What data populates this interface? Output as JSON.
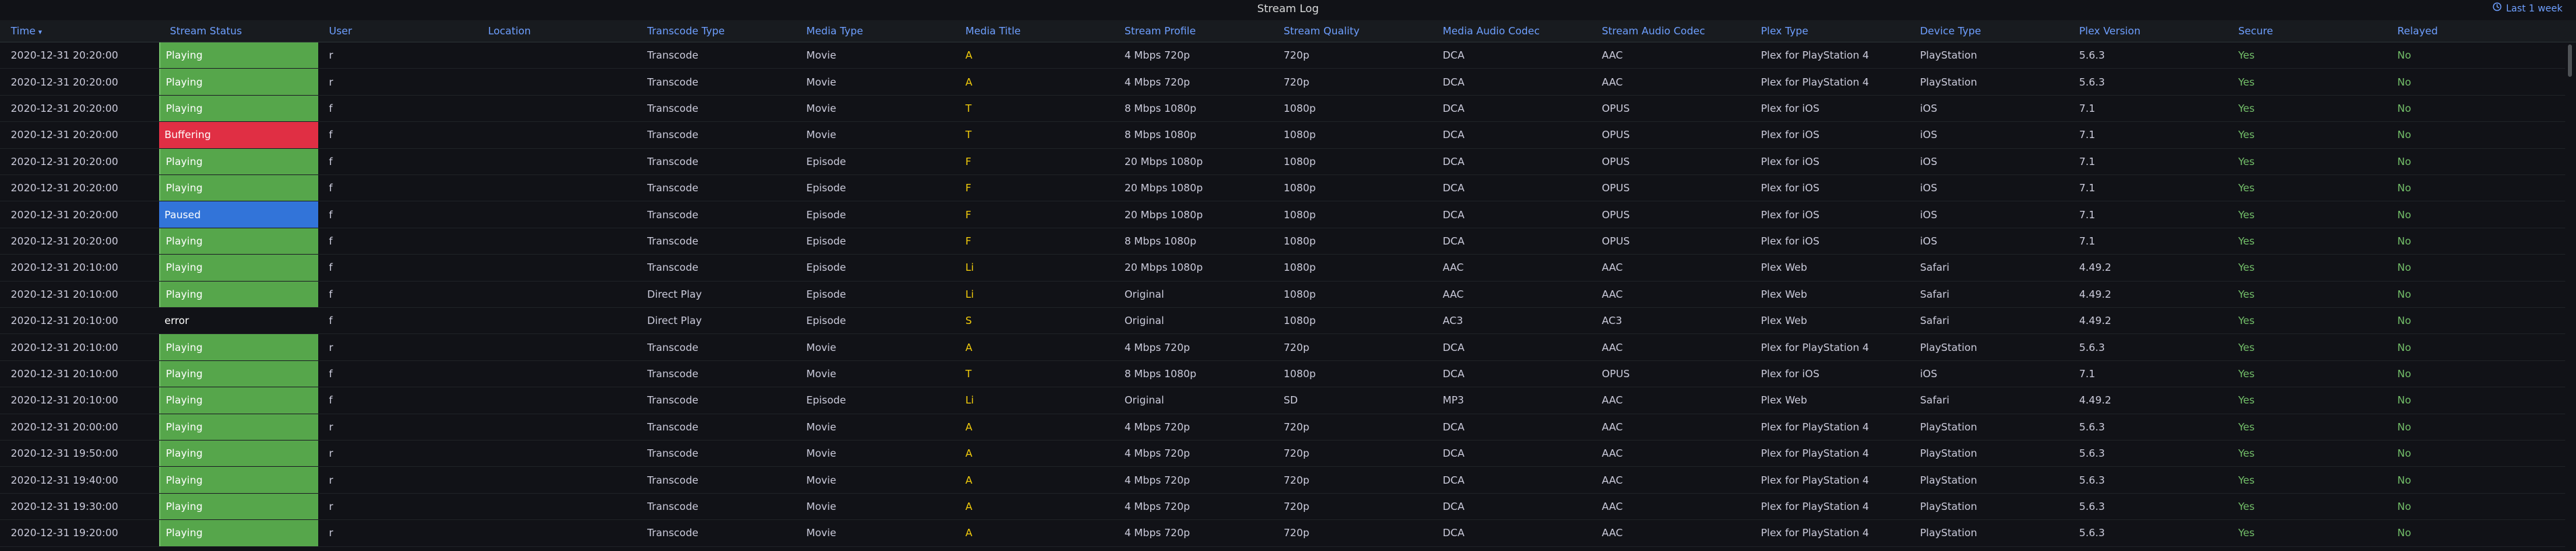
{
  "panel": {
    "title": "Stream Log",
    "time_range_label": "Last 1 week",
    "time_range_icon": "clock-icon",
    "accent": "#6e9fff"
  },
  "columns": [
    {
      "key": "time",
      "label": "Time",
      "sorted": "desc"
    },
    {
      "key": "status",
      "label": "Stream Status"
    },
    {
      "key": "user",
      "label": "User"
    },
    {
      "key": "location",
      "label": "Location"
    },
    {
      "key": "transcode",
      "label": "Transcode Type"
    },
    {
      "key": "media_type",
      "label": "Media Type"
    },
    {
      "key": "media_title",
      "label": "Media Title"
    },
    {
      "key": "profile",
      "label": "Stream Profile"
    },
    {
      "key": "quality",
      "label": "Stream Quality"
    },
    {
      "key": "media_audio",
      "label": "Media Audio Codec"
    },
    {
      "key": "stream_audio",
      "label": "Stream Audio Codec"
    },
    {
      "key": "plex_type",
      "label": "Plex Type"
    },
    {
      "key": "device",
      "label": "Device Type"
    },
    {
      "key": "version",
      "label": "Plex Version"
    },
    {
      "key": "secure",
      "label": "Secure"
    },
    {
      "key": "relayed",
      "label": "Relayed"
    }
  ],
  "status_colors": {
    "Playing": "#56a64b",
    "Buffering": "#e02f44",
    "Paused": "#3274d9",
    "error": "transparent"
  },
  "rows": [
    {
      "time": "2020-12-31 20:20:00",
      "status": "Playing",
      "user": "r",
      "location": "",
      "transcode": "Transcode",
      "media_type": "Movie",
      "media_title": "A",
      "profile": "4 Mbps 720p",
      "quality": "720p",
      "media_audio": "DCA",
      "stream_audio": "AAC",
      "plex_type": "Plex for PlayStation 4",
      "device": "PlayStation",
      "version": "5.6.3",
      "secure": "Yes",
      "relayed": "No"
    },
    {
      "time": "2020-12-31 20:20:00",
      "status": "Playing",
      "user": "r",
      "location": "",
      "transcode": "Transcode",
      "media_type": "Movie",
      "media_title": "A",
      "profile": "4 Mbps 720p",
      "quality": "720p",
      "media_audio": "DCA",
      "stream_audio": "AAC",
      "plex_type": "Plex for PlayStation 4",
      "device": "PlayStation",
      "version": "5.6.3",
      "secure": "Yes",
      "relayed": "No"
    },
    {
      "time": "2020-12-31 20:20:00",
      "status": "Playing",
      "user": "f",
      "location": "",
      "transcode": "Transcode",
      "media_type": "Movie",
      "media_title": "T",
      "profile": "8 Mbps 1080p",
      "quality": "1080p",
      "media_audio": "DCA",
      "stream_audio": "OPUS",
      "plex_type": "Plex for iOS",
      "device": "iOS",
      "version": "7.1",
      "secure": "Yes",
      "relayed": "No"
    },
    {
      "time": "2020-12-31 20:20:00",
      "status": "Buffering",
      "user": "f",
      "location": "",
      "transcode": "Transcode",
      "media_type": "Movie",
      "media_title": "T",
      "profile": "8 Mbps 1080p",
      "quality": "1080p",
      "media_audio": "DCA",
      "stream_audio": "OPUS",
      "plex_type": "Plex for iOS",
      "device": "iOS",
      "version": "7.1",
      "secure": "Yes",
      "relayed": "No"
    },
    {
      "time": "2020-12-31 20:20:00",
      "status": "Playing",
      "user": "f",
      "location": "",
      "transcode": "Transcode",
      "media_type": "Episode",
      "media_title": "F",
      "profile": "20 Mbps 1080p",
      "quality": "1080p",
      "media_audio": "DCA",
      "stream_audio": "OPUS",
      "plex_type": "Plex for iOS",
      "device": "iOS",
      "version": "7.1",
      "secure": "Yes",
      "relayed": "No"
    },
    {
      "time": "2020-12-31 20:20:00",
      "status": "Playing",
      "user": "f",
      "location": "",
      "transcode": "Transcode",
      "media_type": "Episode",
      "media_title": "F",
      "profile": "20 Mbps 1080p",
      "quality": "1080p",
      "media_audio": "DCA",
      "stream_audio": "OPUS",
      "plex_type": "Plex for iOS",
      "device": "iOS",
      "version": "7.1",
      "secure": "Yes",
      "relayed": "No"
    },
    {
      "time": "2020-12-31 20:20:00",
      "status": "Paused",
      "user": "f",
      "location": "",
      "transcode": "Transcode",
      "media_type": "Episode",
      "media_title": "F",
      "profile": "20 Mbps 1080p",
      "quality": "1080p",
      "media_audio": "DCA",
      "stream_audio": "OPUS",
      "plex_type": "Plex for iOS",
      "device": "iOS",
      "version": "7.1",
      "secure": "Yes",
      "relayed": "No"
    },
    {
      "time": "2020-12-31 20:20:00",
      "status": "Playing",
      "user": "f",
      "location": "",
      "transcode": "Transcode",
      "media_type": "Episode",
      "media_title": "F",
      "profile": "8 Mbps 1080p",
      "quality": "1080p",
      "media_audio": "DCA",
      "stream_audio": "OPUS",
      "plex_type": "Plex for iOS",
      "device": "iOS",
      "version": "7.1",
      "secure": "Yes",
      "relayed": "No"
    },
    {
      "time": "2020-12-31 20:10:00",
      "status": "Playing",
      "user": "f",
      "location": "",
      "transcode": "Transcode",
      "media_type": "Episode",
      "media_title": "Li",
      "profile": "20 Mbps 1080p",
      "quality": "1080p",
      "media_audio": "AAC",
      "stream_audio": "AAC",
      "plex_type": "Plex Web",
      "device": "Safari",
      "version": "4.49.2",
      "secure": "Yes",
      "relayed": "No"
    },
    {
      "time": "2020-12-31 20:10:00",
      "status": "Playing",
      "user": "f",
      "location": "",
      "transcode": "Direct Play",
      "media_type": "Episode",
      "media_title": "Li",
      "profile": "Original",
      "quality": "1080p",
      "media_audio": "AAC",
      "stream_audio": "AAC",
      "plex_type": "Plex Web",
      "device": "Safari",
      "version": "4.49.2",
      "secure": "Yes",
      "relayed": "No"
    },
    {
      "time": "2020-12-31 20:10:00",
      "status": "error",
      "user": "f",
      "location": "",
      "transcode": "Direct Play",
      "media_type": "Episode",
      "media_title": "S",
      "profile": "Original",
      "quality": "1080p",
      "media_audio": "AC3",
      "stream_audio": "AC3",
      "plex_type": "Plex Web",
      "device": "Safari",
      "version": "4.49.2",
      "secure": "Yes",
      "relayed": "No"
    },
    {
      "time": "2020-12-31 20:10:00",
      "status": "Playing",
      "user": "r",
      "location": "",
      "transcode": "Transcode",
      "media_type": "Movie",
      "media_title": "A",
      "profile": "4 Mbps 720p",
      "quality": "720p",
      "media_audio": "DCA",
      "stream_audio": "AAC",
      "plex_type": "Plex for PlayStation 4",
      "device": "PlayStation",
      "version": "5.6.3",
      "secure": "Yes",
      "relayed": "No"
    },
    {
      "time": "2020-12-31 20:10:00",
      "status": "Playing",
      "user": "f",
      "location": "",
      "transcode": "Transcode",
      "media_type": "Movie",
      "media_title": "T",
      "profile": "8 Mbps 1080p",
      "quality": "1080p",
      "media_audio": "DCA",
      "stream_audio": "OPUS",
      "plex_type": "Plex for iOS",
      "device": "iOS",
      "version": "7.1",
      "secure": "Yes",
      "relayed": "No"
    },
    {
      "time": "2020-12-31 20:10:00",
      "status": "Playing",
      "user": "f",
      "location": "",
      "transcode": "Transcode",
      "media_type": "Episode",
      "media_title": "Li",
      "profile": "Original",
      "quality": "SD",
      "media_audio": "MP3",
      "stream_audio": "AAC",
      "plex_type": "Plex Web",
      "device": "Safari",
      "version": "4.49.2",
      "secure": "Yes",
      "relayed": "No"
    },
    {
      "time": "2020-12-31 20:00:00",
      "status": "Playing",
      "user": "r",
      "location": "",
      "transcode": "Transcode",
      "media_type": "Movie",
      "media_title": "A",
      "profile": "4 Mbps 720p",
      "quality": "720p",
      "media_audio": "DCA",
      "stream_audio": "AAC",
      "plex_type": "Plex for PlayStation 4",
      "device": "PlayStation",
      "version": "5.6.3",
      "secure": "Yes",
      "relayed": "No"
    },
    {
      "time": "2020-12-31 19:50:00",
      "status": "Playing",
      "user": "r",
      "location": "",
      "transcode": "Transcode",
      "media_type": "Movie",
      "media_title": "A",
      "profile": "4 Mbps 720p",
      "quality": "720p",
      "media_audio": "DCA",
      "stream_audio": "AAC",
      "plex_type": "Plex for PlayStation 4",
      "device": "PlayStation",
      "version": "5.6.3",
      "secure": "Yes",
      "relayed": "No"
    },
    {
      "time": "2020-12-31 19:40:00",
      "status": "Playing",
      "user": "r",
      "location": "",
      "transcode": "Transcode",
      "media_type": "Movie",
      "media_title": "A",
      "profile": "4 Mbps 720p",
      "quality": "720p",
      "media_audio": "DCA",
      "stream_audio": "AAC",
      "plex_type": "Plex for PlayStation 4",
      "device": "PlayStation",
      "version": "5.6.3",
      "secure": "Yes",
      "relayed": "No"
    },
    {
      "time": "2020-12-31 19:30:00",
      "status": "Playing",
      "user": "r",
      "location": "",
      "transcode": "Transcode",
      "media_type": "Movie",
      "media_title": "A",
      "profile": "4 Mbps 720p",
      "quality": "720p",
      "media_audio": "DCA",
      "stream_audio": "AAC",
      "plex_type": "Plex for PlayStation 4",
      "device": "PlayStation",
      "version": "5.6.3",
      "secure": "Yes",
      "relayed": "No"
    },
    {
      "time": "2020-12-31 19:20:00",
      "status": "Playing",
      "user": "r",
      "location": "",
      "transcode": "Transcode",
      "media_type": "Movie",
      "media_title": "A",
      "profile": "4 Mbps 720p",
      "quality": "720p",
      "media_audio": "DCA",
      "stream_audio": "AAC",
      "plex_type": "Plex for PlayStation 4",
      "device": "PlayStation",
      "version": "5.6.3",
      "secure": "Yes",
      "relayed": "No"
    }
  ]
}
